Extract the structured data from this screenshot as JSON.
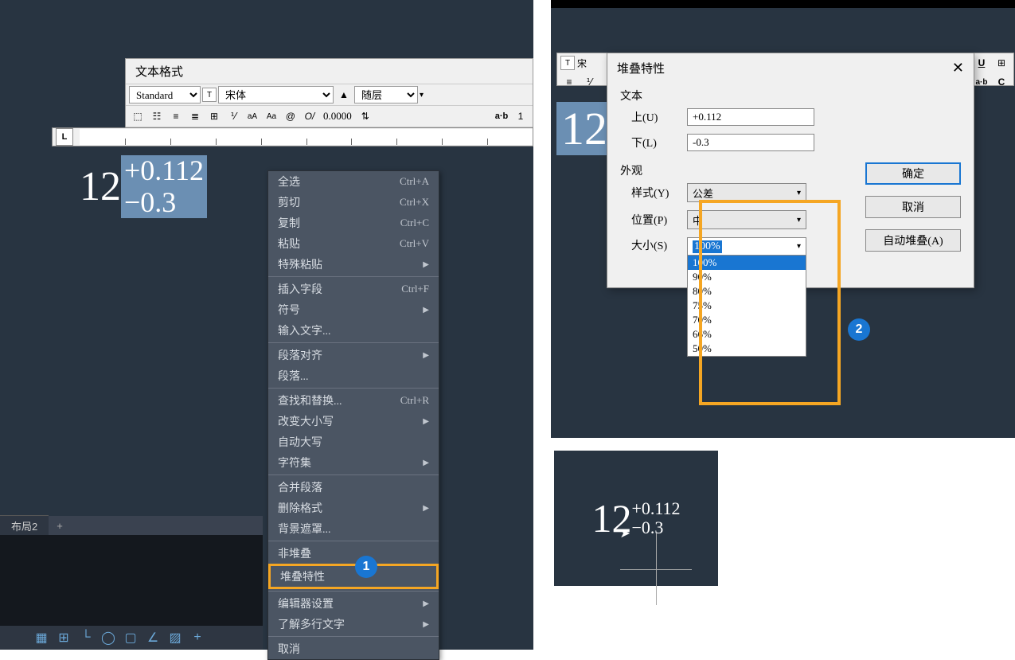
{
  "format_window": {
    "title": "文本格式",
    "style_select": "Standard",
    "font_select": "宋体",
    "layer_select": "随层",
    "toolbar_value": "0.0000"
  },
  "ruler_label": "L",
  "text_number": "12",
  "tolerance_upper": "+0.112",
  "tolerance_lower": "−0.3",
  "ctx_menu": {
    "items": [
      {
        "label": "全选",
        "shortcut": "Ctrl+A"
      },
      {
        "label": "剪切",
        "shortcut": "Ctrl+X"
      },
      {
        "label": "复制",
        "shortcut": "Ctrl+C"
      },
      {
        "label": "粘贴",
        "shortcut": "Ctrl+V"
      },
      {
        "label": "特殊粘贴",
        "arrow": true
      }
    ],
    "group2": [
      {
        "label": "插入字段",
        "shortcut": "Ctrl+F"
      },
      {
        "label": "符号",
        "arrow": true
      },
      {
        "label": "输入文字..."
      }
    ],
    "group3": [
      {
        "label": "段落对齐",
        "arrow": true
      },
      {
        "label": "段落..."
      }
    ],
    "group4": [
      {
        "label": "查找和替换...",
        "shortcut": "Ctrl+R"
      },
      {
        "label": "改变大小写",
        "arrow": true
      },
      {
        "label": "自动大写"
      },
      {
        "label": "字符集",
        "arrow": true
      }
    ],
    "group5": [
      {
        "label": "合并段落"
      },
      {
        "label": "删除格式",
        "arrow": true
      },
      {
        "label": "背景遮罩..."
      }
    ],
    "group6": [
      {
        "label": "非堆叠"
      },
      {
        "label": "堆叠特性",
        "highlighted": true
      }
    ],
    "group7": [
      {
        "label": "编辑器设置",
        "arrow": true
      },
      {
        "label": "了解多行文字",
        "arrow": true
      }
    ],
    "group8": [
      {
        "label": "取消"
      }
    ]
  },
  "badge1": "1",
  "badge2": "2",
  "tab_bar": {
    "tab": "布局2",
    "plus": "+"
  },
  "mini_toolbar_font": "宋",
  "mini_toolbar_u": "U",
  "mini_toolbar_ab": "a·b",
  "stack_dialog": {
    "title": "堆叠特性",
    "text_group": "文本",
    "upper_label": "上(U)",
    "upper_value": "+0.112",
    "lower_label": "下(L)",
    "lower_value": "-0.3",
    "appearance_group": "外观",
    "style_label": "样式(Y)",
    "style_value": "公差",
    "position_label": "位置(P)",
    "position_value": "中",
    "size_label": "大小(S)",
    "size_value": "100%",
    "size_options": [
      "100%",
      "90%",
      "80%",
      "75%",
      "70%",
      "66%",
      "50%"
    ],
    "btn_ok": "确定",
    "btn_cancel": "取消",
    "btn_auto": "自动堆叠(A)"
  },
  "result": {
    "number": "12",
    "upper": "+0.112",
    "lower": "−0.3"
  }
}
